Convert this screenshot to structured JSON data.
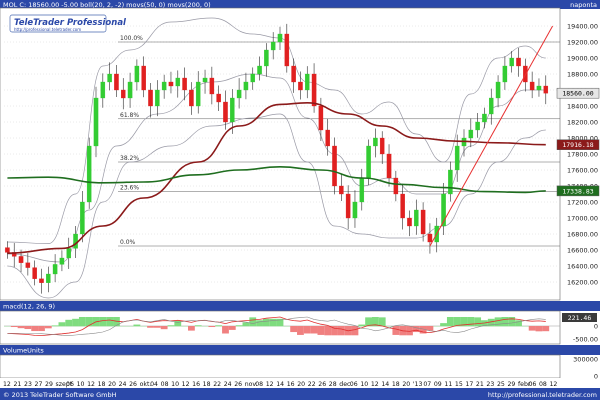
{
  "header": {
    "symbol_line": "MOL C: 18560.00 -5.00 boll(20, 2, -2) movs(50, 0) movs(200, 0)",
    "period_label": "napontа"
  },
  "watermark": {
    "brand": "TeleTrader Professional",
    "url": "http://professional.teletrader.com"
  },
  "footer": {
    "copyright": "© 2013 TeleTrader Software GmbH",
    "url": "http://professional.teletrader.com"
  },
  "macd_panel": {
    "title": "macd(12, 26, 9)",
    "value_badge": "221.46",
    "ticks": [
      {
        "label": "0",
        "value": 0
      },
      {
        "label": "-500.00",
        "value": -500
      }
    ]
  },
  "volume_panel": {
    "title": "VolumeUnits",
    "ticks": [
      {
        "label": "300000",
        "value": 300000
      },
      {
        "label": "0",
        "value": 0
      }
    ]
  },
  "price_badges": [
    {
      "label": "18560.00",
      "value": 18560,
      "color": "#ffffff",
      "bg": "#e0e0e0"
    },
    {
      "label": "17916.18",
      "value": 17916,
      "color": "#ffffff",
      "bg": "#8b1a1a"
    },
    {
      "label": "17338.83",
      "value": 17339,
      "color": "#ffffff",
      "bg": "#1f6e1f"
    }
  ],
  "chart_data": {
    "type": "candlestick",
    "ylim": [
      16000,
      19600
    ],
    "y_ticks": [
      16200,
      16400,
      16600,
      16800,
      17000,
      17200,
      17400,
      17600,
      17800,
      18000,
      18200,
      18400,
      18600,
      18800,
      19000,
      19200,
      19400
    ],
    "x_tick_labels": [
      "12",
      "21",
      "23",
      "27",
      "29",
      "szept",
      "06",
      "10",
      "12",
      "18",
      "20",
      "24",
      "26",
      "okt.",
      "04",
      "08",
      "10",
      "12",
      "16",
      "18",
      "22",
      "24",
      "26",
      "nov.",
      "08",
      "12",
      "14",
      "16",
      "20",
      "22",
      "26",
      "28",
      "dec.",
      "06",
      "10",
      "12",
      "14",
      "18",
      "20",
      "'13",
      "07",
      "09",
      "11",
      "15",
      "17",
      "21",
      "23",
      "25",
      "29",
      "febr.",
      "06",
      "08",
      "12"
    ],
    "fibonacci": [
      {
        "label": "100.0%",
        "value": 19200
      },
      {
        "label": "61.8%",
        "value": 18240
      },
      {
        "label": "38.2%",
        "value": 17700
      },
      {
        "label": "23.6%",
        "value": 17330
      },
      {
        "label": "0.0%",
        "value": 16650
      }
    ],
    "close": [
      16570,
      16520,
      16440,
      16380,
      16240,
      16190,
      16300,
      16420,
      16500,
      16620,
      16800,
      17200,
      17900,
      18500,
      18700,
      18800,
      18600,
      18500,
      18700,
      18900,
      18600,
      18400,
      18600,
      18700,
      18650,
      18750,
      18600,
      18400,
      18700,
      18750,
      18550,
      18450,
      18200,
      18500,
      18600,
      18700,
      18800,
      18900,
      19100,
      19200,
      19300,
      18900,
      18700,
      18600,
      18800,
      18400,
      18100,
      17900,
      17400,
      17300,
      17000,
      17200,
      17500,
      17900,
      18000,
      17800,
      17500,
      17300,
      17000,
      16900,
      17100,
      16800,
      16700,
      16900,
      17300,
      17600,
      17900,
      18000,
      18100,
      18200,
      18300,
      18500,
      18700,
      18900,
      19000,
      18900,
      18700,
      18600,
      18650,
      18560
    ],
    "series": [
      {
        "name": "movs(50, 0)",
        "color": "#8b1a1a",
        "points": [
          [
            0,
            16560
          ],
          [
            8,
            16620
          ],
          [
            14,
            16900
          ],
          [
            20,
            17250
          ],
          [
            28,
            17700
          ],
          [
            34,
            18150
          ],
          [
            40,
            18420
          ],
          [
            44,
            18440
          ],
          [
            50,
            18300
          ],
          [
            55,
            18150
          ],
          [
            60,
            18000
          ],
          [
            66,
            17960
          ],
          [
            72,
            17940
          ],
          [
            79,
            17916
          ]
        ]
      },
      {
        "name": "movs(200, 0)",
        "color": "#1f6e1f",
        "points": [
          [
            0,
            17500
          ],
          [
            6,
            17510
          ],
          [
            14,
            17440
          ],
          [
            20,
            17450
          ],
          [
            28,
            17540
          ],
          [
            34,
            17600
          ],
          [
            40,
            17640
          ],
          [
            46,
            17600
          ],
          [
            52,
            17500
          ],
          [
            58,
            17420
          ],
          [
            64,
            17380
          ],
          [
            70,
            17330
          ],
          [
            76,
            17320
          ],
          [
            79,
            17339
          ]
        ]
      },
      {
        "name": "boll upper",
        "color": "#9a9aa6",
        "points": [
          [
            0,
            16700
          ],
          [
            6,
            16680
          ],
          [
            10,
            17300
          ],
          [
            14,
            18900
          ],
          [
            18,
            19100
          ],
          [
            24,
            19450
          ],
          [
            30,
            19500
          ],
          [
            36,
            19300
          ],
          [
            40,
            19250
          ],
          [
            44,
            18700
          ],
          [
            48,
            18600
          ],
          [
            52,
            18300
          ],
          [
            56,
            18450
          ],
          [
            60,
            18050
          ],
          [
            64,
            17700
          ],
          [
            68,
            18550
          ],
          [
            72,
            19000
          ],
          [
            76,
            19150
          ],
          [
            79,
            19000
          ]
        ]
      },
      {
        "name": "boll lower",
        "color": "#9a9aa6",
        "points": [
          [
            0,
            16400
          ],
          [
            6,
            16000
          ],
          [
            10,
            16200
          ],
          [
            14,
            17200
          ],
          [
            18,
            17700
          ],
          [
            24,
            17900
          ],
          [
            30,
            18150
          ],
          [
            36,
            18250
          ],
          [
            40,
            18300
          ],
          [
            44,
            17700
          ],
          [
            48,
            16900
          ],
          [
            52,
            16800
          ],
          [
            56,
            16750
          ],
          [
            60,
            16750
          ],
          [
            64,
            16900
          ],
          [
            68,
            17300
          ],
          [
            72,
            17700
          ],
          [
            76,
            18000
          ],
          [
            79,
            18100
          ]
        ]
      },
      {
        "name": "boll mid",
        "color": "#9a9aa6",
        "points": [
          [
            0,
            16550
          ],
          [
            8,
            16450
          ],
          [
            12,
            17100
          ],
          [
            16,
            17900
          ],
          [
            22,
            18300
          ],
          [
            30,
            18700
          ],
          [
            36,
            18800
          ],
          [
            40,
            18750
          ],
          [
            44,
            18250
          ],
          [
            48,
            17800
          ],
          [
            52,
            17400
          ],
          [
            56,
            17500
          ],
          [
            60,
            17300
          ],
          [
            64,
            17300
          ],
          [
            68,
            17900
          ],
          [
            72,
            18400
          ],
          [
            76,
            18600
          ],
          [
            79,
            18600
          ]
        ]
      }
    ],
    "trendline": {
      "color": "#e83030",
      "from": [
        62,
        16650
      ],
      "to": [
        80,
        19400
      ]
    }
  }
}
